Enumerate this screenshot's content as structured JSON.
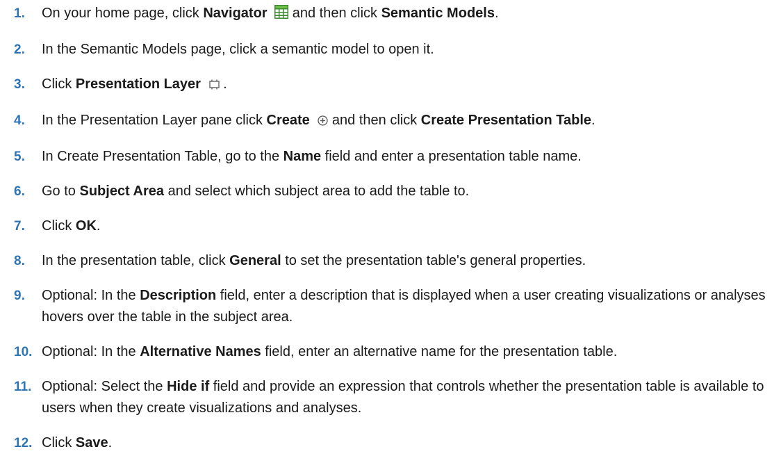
{
  "steps": [
    {
      "num": "1.",
      "parts": [
        {
          "t": "On your home page, click "
        },
        {
          "t": "Navigator",
          "b": true
        },
        {
          "icon": "navigator-grid-icon"
        },
        {
          "t": " and then click "
        },
        {
          "t": "Semantic Models",
          "b": true
        },
        {
          "t": "."
        }
      ]
    },
    {
      "num": "2.",
      "parts": [
        {
          "t": "In the Semantic Models page, click a semantic model to open it."
        }
      ]
    },
    {
      "num": "3.",
      "parts": [
        {
          "t": "Click "
        },
        {
          "t": "Presentation Layer",
          "b": true
        },
        {
          "icon": "presentation-layer-icon"
        },
        {
          "t": "."
        }
      ]
    },
    {
      "num": "4.",
      "parts": [
        {
          "t": "In the Presentation Layer pane click "
        },
        {
          "t": "Create",
          "b": true
        },
        {
          "icon": "create-plus-icon"
        },
        {
          "t": " and then click "
        },
        {
          "t": "Create Presentation Table",
          "b": true
        },
        {
          "t": "."
        }
      ]
    },
    {
      "num": "5.",
      "parts": [
        {
          "t": "In Create Presentation Table, go to the "
        },
        {
          "t": "Name",
          "b": true
        },
        {
          "t": " field and enter a presentation table name."
        }
      ]
    },
    {
      "num": "6.",
      "parts": [
        {
          "t": "Go to "
        },
        {
          "t": "Subject Area",
          "b": true
        },
        {
          "t": " and select which subject area to add the table to."
        }
      ]
    },
    {
      "num": "7.",
      "parts": [
        {
          "t": "Click "
        },
        {
          "t": "OK",
          "b": true
        },
        {
          "t": "."
        }
      ]
    },
    {
      "num": "8.",
      "parts": [
        {
          "t": "In the presentation table, click "
        },
        {
          "t": "General",
          "b": true
        },
        {
          "t": " to set the presentation table's general properties."
        }
      ]
    },
    {
      "num": "9.",
      "parts": [
        {
          "t": "Optional: In the "
        },
        {
          "t": "Description",
          "b": true
        },
        {
          "t": " field, enter a description that is displayed when a user creating visualizations or analyses hovers over the table in the subject area."
        }
      ]
    },
    {
      "num": "10.",
      "parts": [
        {
          "t": "Optional: In the "
        },
        {
          "t": "Alternative Names",
          "b": true
        },
        {
          "t": " field, enter an alternative name for the presentation table."
        }
      ]
    },
    {
      "num": "11.",
      "parts": [
        {
          "t": "Optional: Select the "
        },
        {
          "t": "Hide if",
          "b": true
        },
        {
          "t": " field and provide an expression that controls whether the presentation table is available to users when they create visualizations and analyses."
        }
      ]
    },
    {
      "num": "12.",
      "parts": [
        {
          "t": "Click "
        },
        {
          "t": "Save",
          "b": true
        },
        {
          "t": "."
        }
      ]
    }
  ]
}
